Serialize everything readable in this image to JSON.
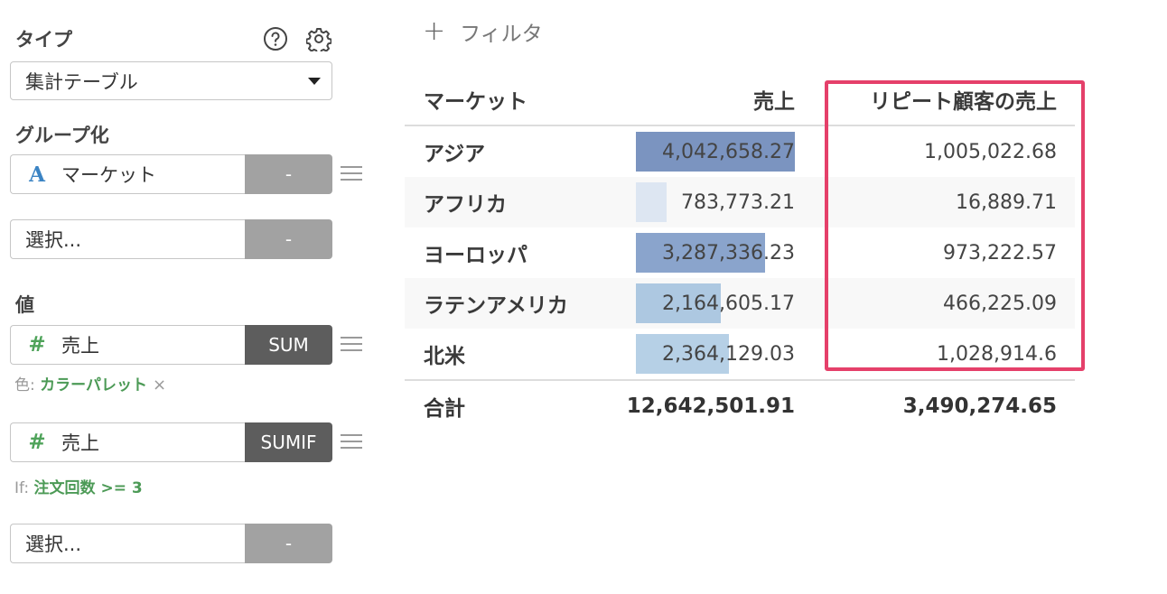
{
  "panel": {
    "type_label": "タイプ",
    "type_value": "集計テーブル",
    "group_label": "グループ化",
    "group_field": {
      "name": "マーケット",
      "type_glyph": "A",
      "action": "-"
    },
    "group_select": {
      "placeholder": "選択...",
      "action": "-"
    },
    "value_label": "値",
    "value1": {
      "glyph": "#",
      "name": "売上",
      "agg": "SUM"
    },
    "color_row": {
      "prefix": "色: ",
      "value": "カラーパレット",
      "remove": "×"
    },
    "value2": {
      "glyph": "#",
      "name": "売上",
      "agg": "SUMIF"
    },
    "if_row": {
      "prefix": "If: ",
      "value": "注文回数 >= 3"
    },
    "value_select": {
      "placeholder": "選択...",
      "action": "-"
    }
  },
  "toolbar": {
    "plus": "+",
    "filter_label": "フィルタ"
  },
  "table": {
    "headers": [
      "マーケット",
      "売上",
      "リピート顧客の売上"
    ],
    "rows": [
      {
        "market": "アジア",
        "sales": "4,042,658.27",
        "repeat": "1,005,022.68"
      },
      {
        "market": "アフリカ",
        "sales": "783,773.21",
        "repeat": "16,889.71"
      },
      {
        "market": "ヨーロッパ",
        "sales": "3,287,336.23",
        "repeat": "973,222.57"
      },
      {
        "market": "ラテンアメリカ",
        "sales": "2,164,605.17",
        "repeat": "466,225.09"
      },
      {
        "market": "北米",
        "sales": "2,364,129.03",
        "repeat": "1,028,914.6"
      }
    ],
    "total": {
      "label": "合計",
      "sales": "12,642,501.91",
      "repeat": "3,490,274.65"
    },
    "bar_fractions": [
      1.0,
      0.194,
      0.813,
      0.535,
      0.585
    ],
    "bar_colors": [
      "#7b94c0",
      "#dde6f2",
      "#8aa4cc",
      "#adc8e1",
      "#b6d0e6"
    ]
  },
  "colors": {
    "highlight": "#e5406a",
    "accent_green": "#4c9a56",
    "type_blue": "#3b84c4"
  }
}
